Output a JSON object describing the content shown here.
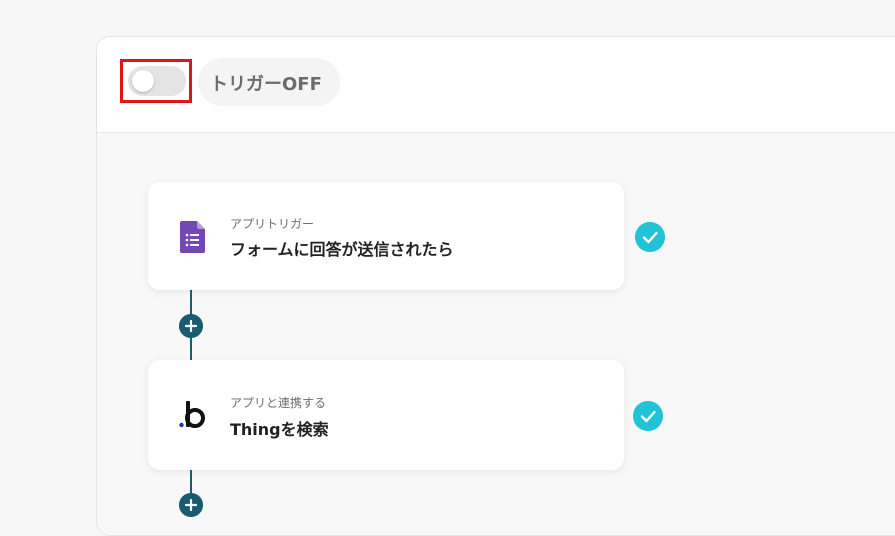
{
  "header": {
    "toggle_state": "off",
    "toggle_label": "トリガーOFF"
  },
  "flow": {
    "steps": [
      {
        "subtitle": "アプリトリガー",
        "title": "フォームに回答が送信されたら",
        "icon": "google-forms-icon",
        "status": "completed"
      },
      {
        "subtitle": "アプリと連携する",
        "title": "Thingを検索",
        "icon": "bubble-icon",
        "status": "completed"
      }
    ]
  },
  "colors": {
    "highlight": "#d8161b",
    "check": "#22c3d6",
    "connector": "#1e5a6f",
    "forms_purple": "#7248b9"
  }
}
